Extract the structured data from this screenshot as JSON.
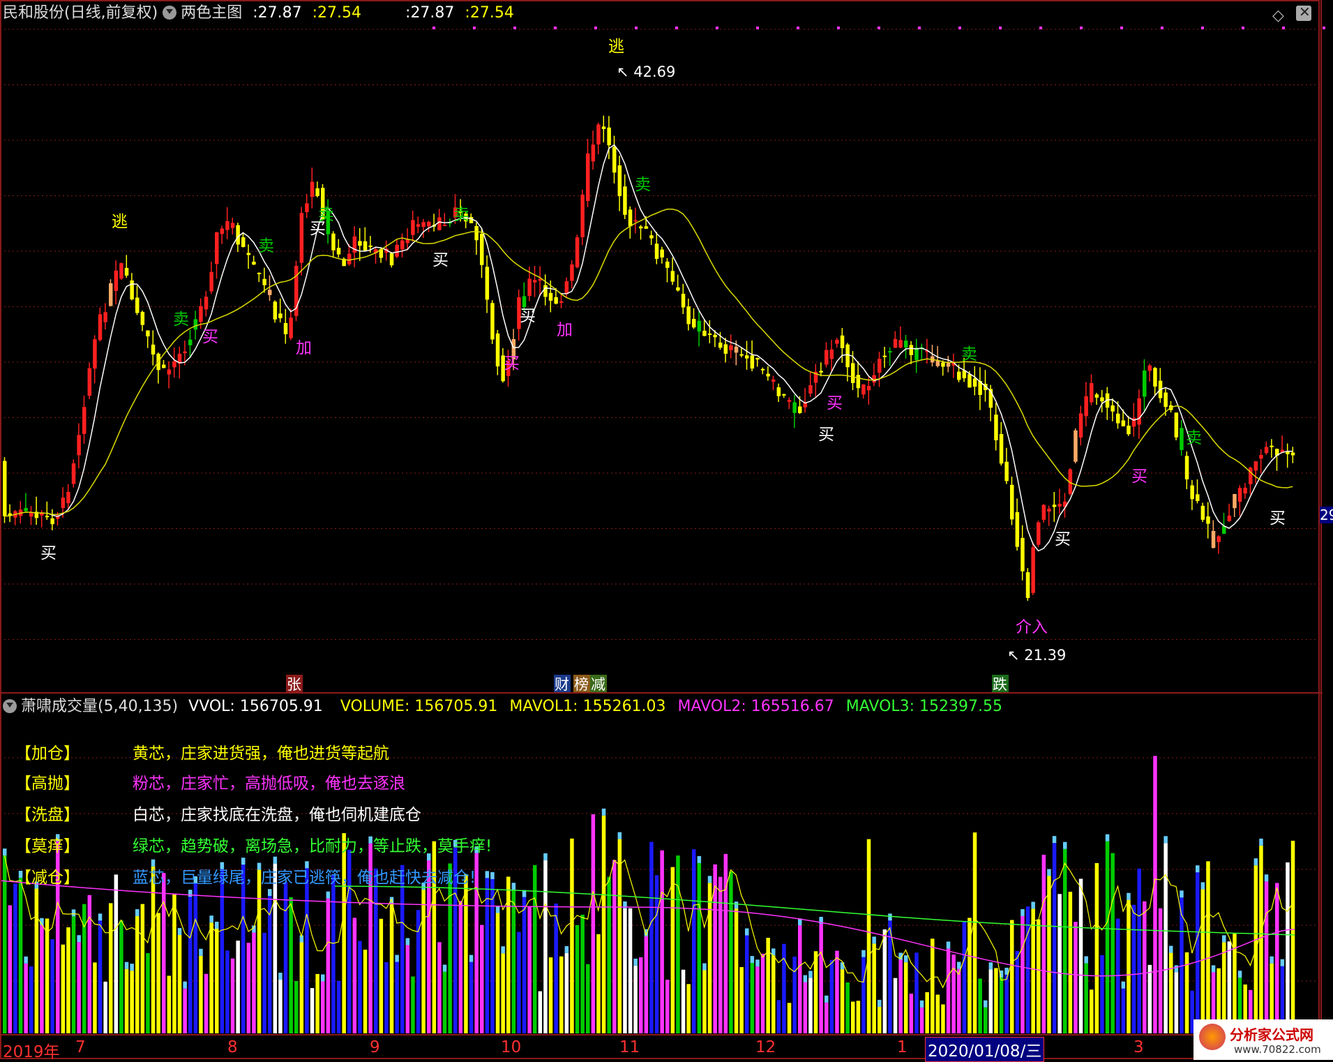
{
  "header": {
    "stock": "民和股份",
    "period": "(日线,前复权)",
    "indicator": "两色主图",
    "v1_label": ":",
    "v1": "27.87",
    "v2_label": ":",
    "v2": "27.54",
    "v3_label": ":",
    "v3": "27.87",
    "v4_label": ":",
    "v4": "27.54"
  },
  "sub_header": {
    "name": "萧啸成交量(5,40,135)",
    "vvol": "VVOL: 156705.91",
    "volume": "VOLUME: 156705.91",
    "mavol1": "MAVOL1: 155261.03",
    "mavol2": "MAVOL2: 165516.67",
    "mavol3": "MAVOL3: 152397.55"
  },
  "legend": [
    {
      "tag": "【加仓】",
      "text": "黄芯，庄家进货强，俺也进货等起航",
      "color": "#ffff00"
    },
    {
      "tag": "【高抛】",
      "text": "粉芯，庄家忙，高抛低吸，俺也去逐浪",
      "color": "#ff33ff"
    },
    {
      "tag": "【洗盘】",
      "text": "白芯，庄家找底在洗盘，俺也伺机建底仓",
      "color": "#ffffff"
    },
    {
      "tag": "【莫痒】",
      "text": "绿芯，趋势破，离场急，比耐力，等止跌，莫手痒!",
      "color": "#33ff33"
    },
    {
      "tag": "【减仓】",
      "text": "蓝芯，巨量绿尾，庄家已逃筷，俺也赶快去减仓!",
      "color": "#3399ff"
    }
  ],
  "annotations": {
    "high": "42.69",
    "low": "21.39",
    "tao": "逃",
    "mai": "买",
    "mai_sell": "卖",
    "jia": "加",
    "jieru": "介入",
    "zhang": "张",
    "cai": "财",
    "bang": "榜",
    "jian": "减",
    "die": "跌"
  },
  "axis": {
    "year": "2019年",
    "months": [
      "7",
      "8",
      "9",
      "10",
      "11",
      "12",
      "1",
      "3"
    ],
    "date_box": "2020/01/08/三",
    "right_price": "29"
  },
  "colors": {
    "red": "#ff2020",
    "yellow": "#ffff00",
    "green": "#00cc00",
    "pink": "#ff33ff",
    "blue": "#1a1aff",
    "cyan": "#66ccff",
    "white": "#ffffff",
    "orange": "#ffaa66",
    "grid": "#8b1a1a"
  },
  "watermark": {
    "title": "分析家公式网",
    "url": "www.70822.com"
  }
}
